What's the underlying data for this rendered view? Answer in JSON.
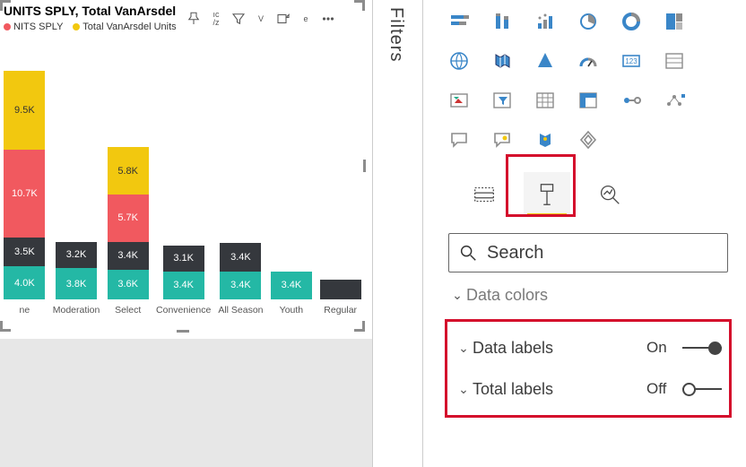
{
  "filters_tab_label": "Filters",
  "visual": {
    "title": "UNITS SPLY, Total VanArsdel U",
    "legend": [
      {
        "label": "NITS SPLY",
        "color": "#f1595f"
      },
      {
        "label": "Total VanArsdel Units",
        "color": "#f2c80f"
      }
    ],
    "header_hints": [
      "ıc",
      "V",
      "e"
    ],
    "header_sub": [
      "/z"
    ]
  },
  "chart_data": {
    "type": "bar",
    "stacked": true,
    "unit": "K",
    "series_colors": [
      "#24b8a5",
      "#35383d",
      "#f1595f",
      "#f2c80f"
    ],
    "categories": [
      "ne",
      "Moderation",
      "Select",
      "Convenience",
      "All Season",
      "Youth",
      "Regular"
    ],
    "series": [
      {
        "name": "teal",
        "values": [
          4.0,
          3.8,
          3.6,
          3.4,
          3.4,
          3.4,
          null
        ]
      },
      {
        "name": "dark",
        "values": [
          3.5,
          3.2,
          3.4,
          3.1,
          3.4,
          null,
          null
        ]
      },
      {
        "name": "coral",
        "values": [
          10.7,
          null,
          5.7,
          null,
          null,
          null,
          null
        ]
      },
      {
        "name": "gold",
        "values": [
          9.5,
          null,
          5.8,
          null,
          null,
          null,
          null
        ]
      }
    ],
    "labels": [
      [
        "4.0K",
        "3.5K",
        "10.7K",
        "9.5K"
      ],
      [
        "3.8K",
        "3.2K"
      ],
      [
        "3.6K",
        "3.4K",
        "5.7K",
        "5.8K"
      ],
      [
        "3.4K",
        "3.1K"
      ],
      [
        "3.4K",
        "3.4K"
      ],
      [
        "3.4K"
      ],
      []
    ]
  },
  "search": {
    "placeholder": "Search"
  },
  "format_sections": {
    "data_colors": {
      "label": "Data colors"
    },
    "data_labels": {
      "label": "Data labels",
      "state": "On"
    },
    "total_labels": {
      "label": "Total labels",
      "state": "Off"
    }
  },
  "viz_icons": [
    "stacked-bar",
    "stacked-column",
    "clustered-bar",
    "pie",
    "donut",
    "treemap",
    "map",
    "filled-map",
    "azure-map",
    "gauge",
    "card",
    "multi-row-card",
    "kpi",
    "slicer",
    "table",
    "matrix",
    "r-visual",
    "key-influencers",
    "chat",
    "qa-visual",
    "arcgis",
    "powerapps"
  ],
  "tabs": [
    "fields",
    "format",
    "analytics"
  ]
}
